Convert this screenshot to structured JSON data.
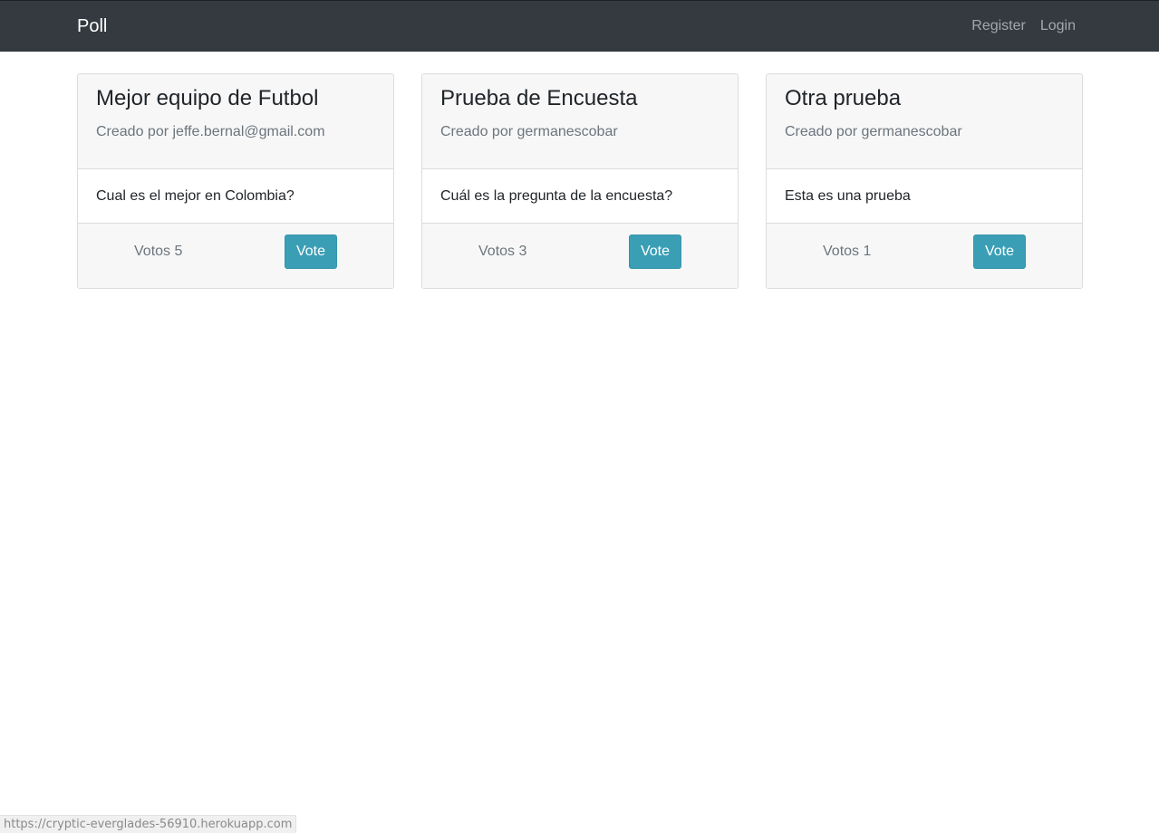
{
  "navbar": {
    "brand": "Poll",
    "links": [
      "Register",
      "Login"
    ]
  },
  "polls": [
    {
      "title": "Mejor equipo de Futbol",
      "subtitle": "Creado por jeffe.bernal@gmail.com",
      "question": "Cual es el mejor en Colombia?",
      "votes": "Votos 5",
      "button": "Vote"
    },
    {
      "title": "Prueba de Encuesta",
      "subtitle": "Creado por germanescobar",
      "question": "Cuál es la pregunta de la encuesta?",
      "votes": "Votos 3",
      "button": "Vote"
    },
    {
      "title": "Otra prueba",
      "subtitle": "Creado por germanescobar",
      "question": "Esta es una prueba",
      "votes": "Votos 1",
      "button": "Vote"
    }
  ],
  "status_bar": {
    "url": "https://cryptic-everglades-56910.herokuapp.com"
  },
  "colors": {
    "navbar": "#343a40",
    "accent": "#3a9fb5"
  }
}
